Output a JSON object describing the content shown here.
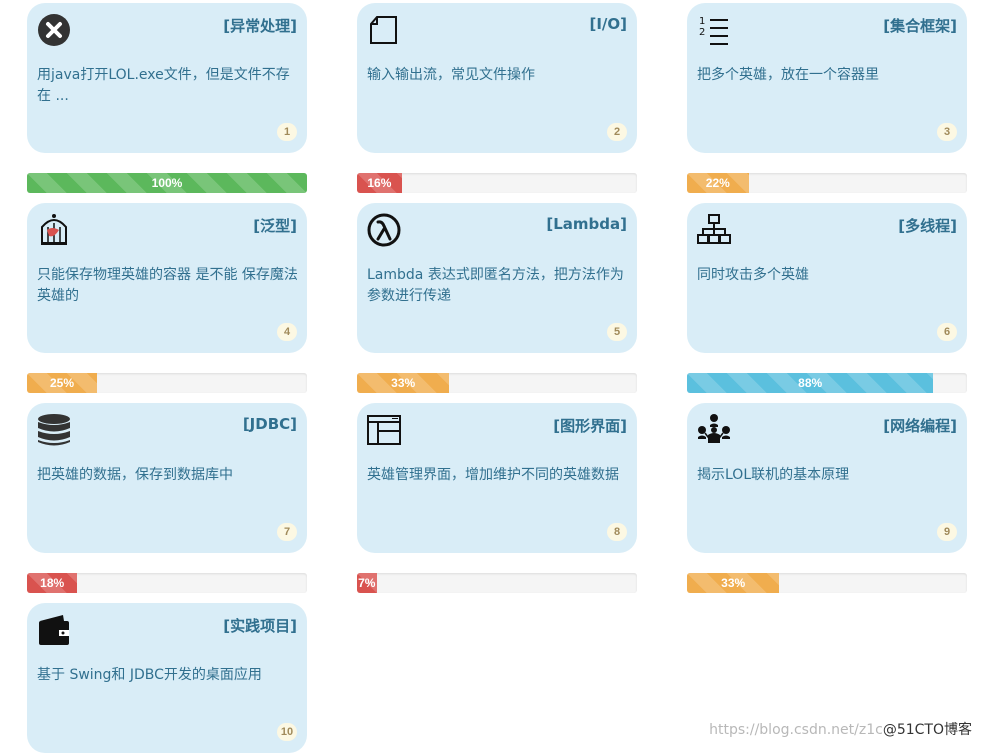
{
  "cards": [
    {
      "icon": "close-circle-icon",
      "title": "[异常处理]",
      "desc": "用java打开LOL.exe文件，但是文件不存在 ...",
      "num": "1",
      "progress": {
        "value": 100,
        "label": "100%",
        "style": "success"
      }
    },
    {
      "icon": "file-icon",
      "title": "[I/O]",
      "desc": "输入输出流，常见文件操作",
      "num": "2",
      "progress": {
        "value": 16,
        "label": "16%",
        "style": "danger"
      }
    },
    {
      "icon": "ordered-list-icon",
      "title": "[集合框架]",
      "desc": "把多个英雄，放在一个容器里",
      "num": "3",
      "progress": {
        "value": 22,
        "label": "22%",
        "style": "warning"
      }
    },
    {
      "icon": "birdcage-icon",
      "title": "[泛型]",
      "desc": "只能保存物理英雄的容器 是不能 保存魔法英雄的",
      "num": "4",
      "progress": {
        "value": 25,
        "label": "25%",
        "style": "warning"
      }
    },
    {
      "icon": "lambda-icon",
      "title": "[Lambda]",
      "desc": "Lambda 表达式即匿名方法，把方法作为参数进行传递",
      "num": "5",
      "progress": {
        "value": 33,
        "label": "33%",
        "style": "warning"
      }
    },
    {
      "icon": "sitemap-icon",
      "title": "[多线程]",
      "desc": "同时攻击多个英雄",
      "num": "6",
      "progress": {
        "value": 88,
        "label": "88%",
        "style": "info"
      }
    },
    {
      "icon": "database-icon",
      "title": "[JDBC]",
      "desc": "把英雄的数据，保存到数据库中",
      "num": "7",
      "progress": {
        "value": 18,
        "label": "18%",
        "style": "danger"
      }
    },
    {
      "icon": "window-layout-icon",
      "title": "[图形界面]",
      "desc": "英雄管理界面，增加维护不同的英雄数据",
      "num": "8",
      "progress": {
        "value": 7,
        "label": "7%",
        "style": "danger"
      }
    },
    {
      "icon": "network-people-icon",
      "title": "[网络编程]",
      "desc": "揭示LOL联机的基本原理",
      "num": "9",
      "progress": {
        "value": 33,
        "label": "33%",
        "style": "warning"
      }
    },
    {
      "icon": "wallet-icon",
      "title": "[实践项目]",
      "desc": "基于 Swing和 JDBC开发的桌面应用",
      "num": "10"
    }
  ],
  "watermark": {
    "url_text": "https://blog.csdn.net/z1c",
    "brand": "@51CTO博客"
  }
}
